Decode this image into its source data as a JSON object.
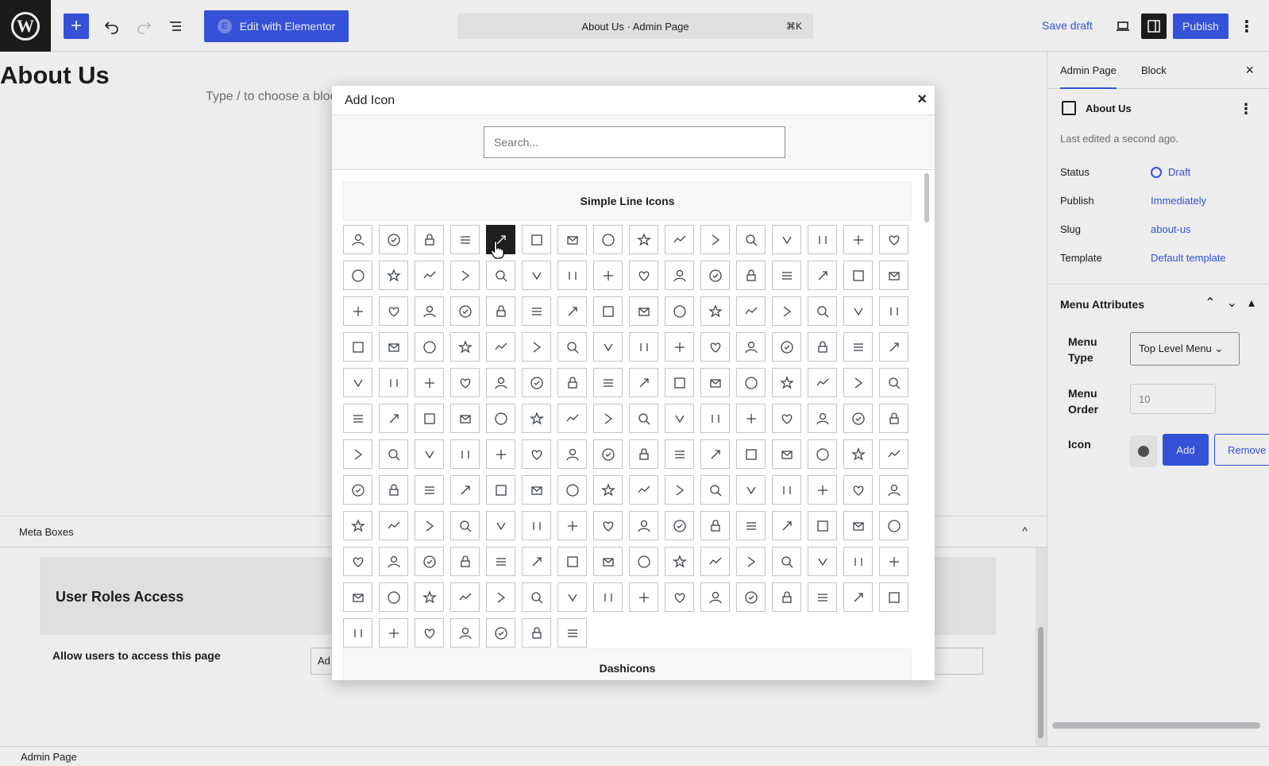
{
  "topbar": {
    "logo_letter": "W",
    "add_symbol": "+",
    "elementor_icon": "E",
    "elementor_label": "Edit with Elementor",
    "command_title": "About Us · Admin Page",
    "command_shortcut": "⌘K",
    "save_draft": "Save draft",
    "publish": "Publish",
    "more": "⋮"
  },
  "editor": {
    "title": "About Us",
    "block_hint": "Type / to choose a block"
  },
  "metaboxes": {
    "label": "Meta Boxes",
    "chevron": "^",
    "roles_heading": "User Roles Access",
    "allow_label": "Allow users to access this page",
    "allow_value": "Ad"
  },
  "footer": {
    "breadcrumb": "Admin Page"
  },
  "sidebar": {
    "tabs": [
      "Admin Page",
      "Block"
    ],
    "close": "×",
    "doc_title": "About Us",
    "doc_more": "⋮",
    "last_edited": "Last edited a second ago.",
    "props": [
      {
        "label": "Status",
        "value": "Draft"
      },
      {
        "label": "Publish",
        "value": "Immediately"
      },
      {
        "label": "Slug",
        "value": "about-us"
      },
      {
        "label": "Template",
        "value": "Default template"
      }
    ],
    "menu_attributes": {
      "heading": "Menu Attributes",
      "ctrl_up": "⌃",
      "ctrl_down": "⌄",
      "ctrl_collapse": "▴",
      "type_label_1": "Menu",
      "type_label_2": "Type",
      "type_value": "Top Level Menu ⌄",
      "order_label_1": "Menu",
      "order_label_2": "Order",
      "order_value": "10",
      "icon_label": "Icon",
      "add": "Add",
      "remove": "Remove"
    }
  },
  "modal": {
    "title": "Add Icon",
    "close": "×",
    "search_placeholder": "Search...",
    "section_1": "Simple Line Icons",
    "section_2": "Dashicons",
    "selected_index": 4,
    "icon_count": 183
  },
  "colors": {
    "accent": "#3858e9",
    "dark": "#1e1e1e",
    "muted": "#757575"
  }
}
